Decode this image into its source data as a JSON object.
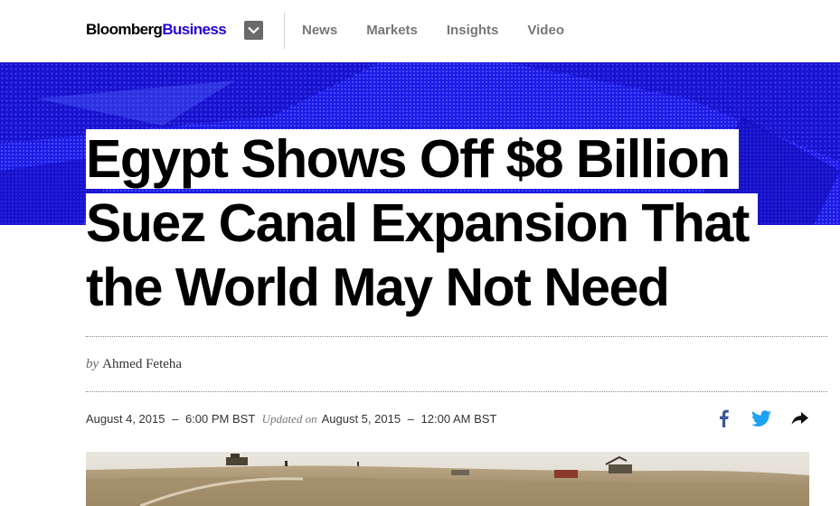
{
  "header": {
    "logo_brand": "Bloomberg",
    "logo_section": "Business",
    "menu_icon": "chevron-down-icon",
    "nav": [
      "News",
      "Markets",
      "Insights",
      "Video"
    ]
  },
  "article": {
    "headline": {
      "line1": "Egypt Shows Off $8 Billion",
      "line2": "Suez Canal Expansion That",
      "line3": "the World May Not Need"
    },
    "byline_prefix": "by",
    "author": "Ahmed Feteha",
    "published_date": "August 4, 2015",
    "published_time": "6:00 PM BST",
    "updated_label": "Updated on",
    "updated_date": "August 5, 2015",
    "updated_time": "12:00 AM BST",
    "dash": "–"
  },
  "share": {
    "icons": [
      "facebook-icon",
      "twitter-icon",
      "share-arrow-icon"
    ]
  },
  "colors": {
    "brand_accent": "#2800d7",
    "hero_blue": "#1f1ae6",
    "facebook": "#3b5998",
    "twitter": "#1da1f2"
  }
}
